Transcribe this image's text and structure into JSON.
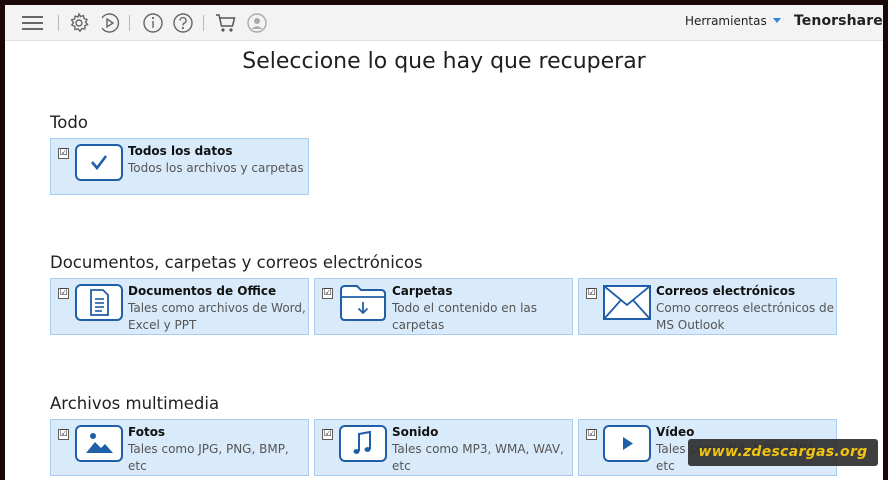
{
  "header": {
    "tools_label": "Herramientas",
    "brand": "Tenorshare"
  },
  "page_title": "Seleccione lo que hay que recuperar",
  "sections": [
    {
      "title": "Todo",
      "cards": [
        {
          "name": "Todos los datos",
          "desc": "Todos los archivos y carpetas",
          "checked": true,
          "icon": "checkmark-icon"
        }
      ]
    },
    {
      "title": "Documentos, carpetas y correos electrónicos",
      "cards": [
        {
          "name": "Documentos de Office",
          "desc": "Tales como archivos de Word, Excel y PPT",
          "checked": true,
          "icon": "document-icon"
        },
        {
          "name": "Carpetas",
          "desc": "Todo el contenido en las carpetas",
          "checked": true,
          "icon": "folder-icon"
        },
        {
          "name": "Correos electrónicos",
          "desc": "Como correos electrónicos de MS Outlook",
          "checked": true,
          "icon": "envelope-icon"
        }
      ]
    },
    {
      "title": "Archivos multimedia",
      "cards": [
        {
          "name": "Fotos",
          "desc": "Tales como JPG, PNG, BMP, etc",
          "checked": true,
          "icon": "image-icon"
        },
        {
          "name": "Sonido",
          "desc": "Tales como MP3, WMA, WAV, etc",
          "checked": true,
          "icon": "music-note-icon"
        },
        {
          "name": "Vídeo",
          "desc": "Tales como AVI, MOV, MP4, etc",
          "checked": true,
          "icon": "play-icon"
        }
      ]
    }
  ],
  "checkbox_glyph": "☑",
  "watermark": "www.zdescargas.org",
  "colors": {
    "accent": "#2f86d6",
    "icon_blue": "#1f5fa8",
    "card_bg": "#d9eafa",
    "card_border": "#a9cdee",
    "watermark_text": "#f2c200"
  }
}
